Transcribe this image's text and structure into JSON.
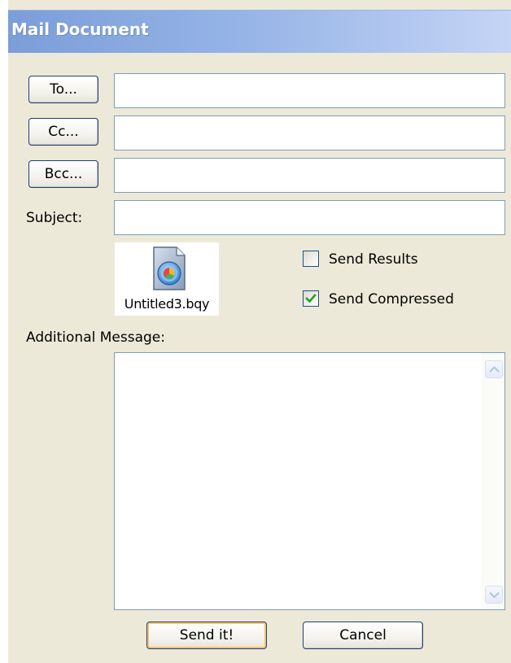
{
  "window": {
    "title": "Mail Document"
  },
  "buttons": {
    "to": "To...",
    "cc": "Cc...",
    "bcc": "Bcc...",
    "send": "Send it!",
    "cancel": "Cancel"
  },
  "fields": {
    "to_value": "",
    "cc_value": "",
    "bcc_value": "",
    "subject_label": "Subject:",
    "subject_value": ""
  },
  "attachment": {
    "filename": "Untitled3.bqy",
    "icon": "bqy-document-icon"
  },
  "options": {
    "send_results": {
      "label": "Send Results",
      "checked": false
    },
    "send_compressed": {
      "label": "Send Compressed",
      "checked": true
    }
  },
  "message": {
    "label": "Additional Message:",
    "value": ""
  },
  "colors": {
    "title_gradient_start": "#7b9ed9",
    "title_gradient_end": "#c5d5f5",
    "window_bg": "#ece9d8",
    "check_green": "#21a121"
  }
}
